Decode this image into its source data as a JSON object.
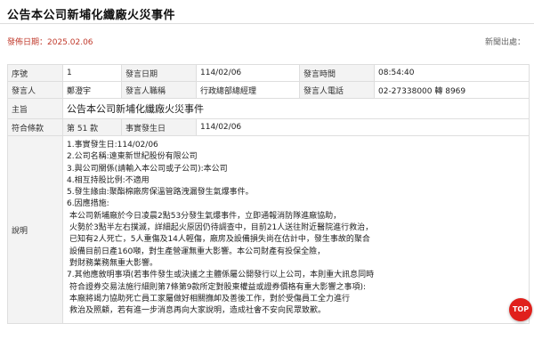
{
  "page": {
    "title": "公告本公司新埔化纖廠火災事件",
    "publish_date": "發佈日期：2025.02.06",
    "news_source": "新聞出處："
  },
  "table": {
    "row1": {
      "seq_label": "序號",
      "seq_value": "1",
      "date_label": "發言日期",
      "date_value": "114/02/06",
      "time_label": "發言時間",
      "time_value": "08:54:40"
    },
    "row2": {
      "speaker_label": "發言人",
      "speaker_value": "鄭澄宇",
      "title_label": "發言人職稱",
      "title_value": "行政總部總經理",
      "phone_label": "發言人電話",
      "phone_value": "02-27338000 轉 8969"
    },
    "row3": {
      "subject_label": "主旨",
      "subject_value": "公告本公司新埔化纖廠火災事件"
    },
    "row4": {
      "clause_label": "符合條款",
      "clause_value": "第 51 款",
      "event_date_label": "事實發生日",
      "event_date_value": "114/02/06"
    },
    "description_label": "說明",
    "description_lines": [
      "1.事實發生日:114/02/06",
      "2.公司名稱:遠東新世紀股份有限公司",
      "3.與公司關係(請輸入本公司或子公司):本公司",
      "4.相互持股比例:不適用",
      "5.發生緣由:聚酯棉廠房保溫管路洩漏發生氣爆事件。",
      "6.因應措施:",
      "本公司新埔廠於今日凌晨2點53分發生氣爆事件，立即通報消防隊進廠協助，",
      "火勢於3點半左右撲滅，詳細起火原因仍待調查中，目前21人送往附近醫院進行救治，",
      "已知有2人死亡，5人重傷及14人輕傷，廠房及設備損失尚在估計中，發生事故的聚合",
      "設備目前日產160噸，對生產營運無重大影響。本公司財產有投保全險，",
      "對財務業務無重大影響。",
      "7.其他應敘明事項(若事件發生或決議之主體係屬公開發行以上公司，本則重大訊息同時",
      "符合證券交易法施行細則第7條第9款所定對股東權益或證券價格有重大影響之事項):",
      "本廠將竭力協助死亡員工家屬做好相關撫卹及善後工作，對於受傷員工全力進行",
      "救治及照顧，若有進一步消息再向大家說明，造成社會不安向民眾致歉。"
    ],
    "description_indent": [
      false,
      false,
      false,
      false,
      false,
      false,
      true,
      true,
      true,
      true,
      true,
      false,
      true,
      true,
      true
    ]
  },
  "top_button": {
    "label": "TOP",
    "color": "#e0201c"
  }
}
